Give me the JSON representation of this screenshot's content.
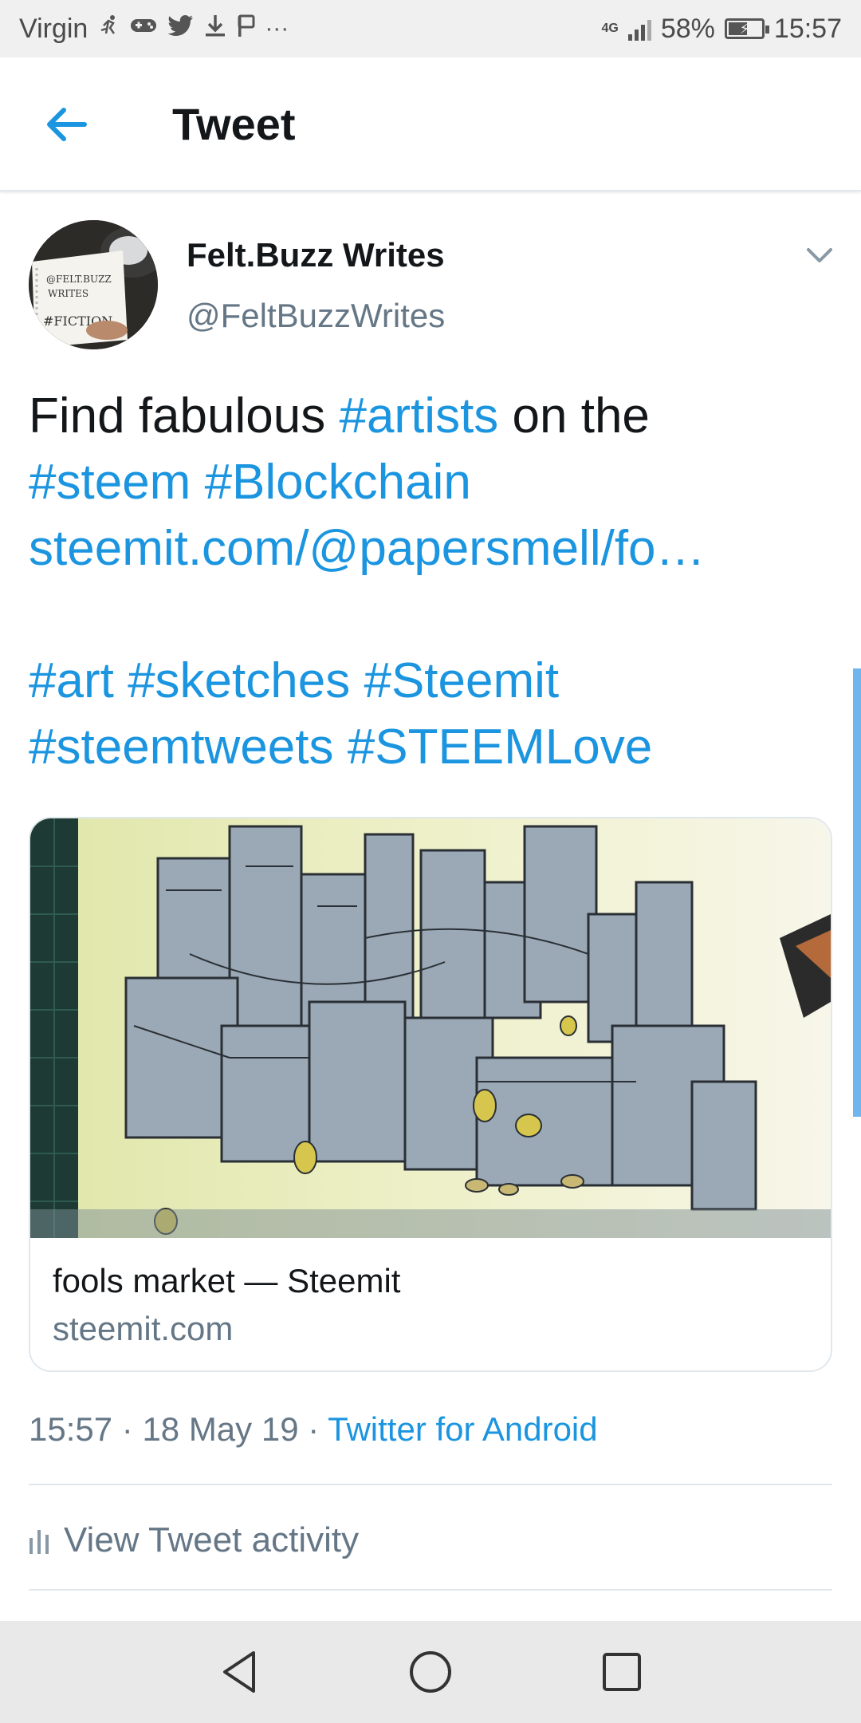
{
  "status_bar": {
    "carrier": "Virgin",
    "network": "4G",
    "battery": "58%",
    "battery_level": 0.58,
    "time": "15:57",
    "overflow": "···"
  },
  "header": {
    "title": "Tweet",
    "back_icon": "arrow-left-icon"
  },
  "tweet": {
    "user": {
      "name": "Felt.Buzz Writes",
      "handle": "@FeltBuzzWrites",
      "avatar_text": [
        "@FELT.BUZZ",
        "WRITES",
        "#FICTION"
      ]
    },
    "text": {
      "t1": "Find fabulous ",
      "h1": "#artists",
      "t2": " on the",
      "h2": "#steem",
      "h3": "#Blockchain",
      "link": "steemit.com/@papersmell/fo…",
      "h4": "#art",
      "h5": "#sketches",
      "h6": "#Steemit",
      "h7": "#steemtweets",
      "h8": "#STEEMLove"
    },
    "card": {
      "title": "fools market — Steemit",
      "domain": "steemit.com"
    },
    "meta": {
      "time": "15:57",
      "sep1": " · ",
      "date": "18 May 19",
      "sep2": " · ",
      "source": "Twitter for Android"
    },
    "activity_label": "View Tweet activity"
  },
  "colors": {
    "accent": "#1b95e0",
    "text": "#14171a",
    "secondary": "#657786",
    "divider": "#e1e8ed"
  }
}
